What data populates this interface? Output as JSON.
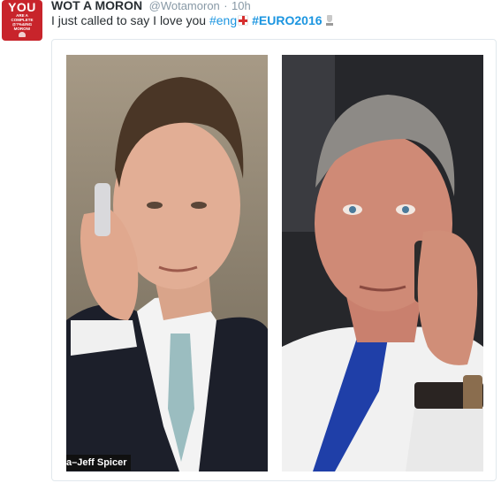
{
  "tweet": {
    "avatar": {
      "line1": "YOU",
      "line2": "ARE A COMPLETE",
      "line3": "@?%&ING",
      "line4": "MORON!"
    },
    "author_name": "WOT A MORON",
    "author_handle": "@Wotamoron",
    "separator": "·",
    "timestamp": "10h",
    "text_prefix": "I just called to say I love you ",
    "hashtag_eng": "#eng",
    "hashtag_euro": "#EURO2016",
    "emoji": {
      "flag": "england-flag-icon",
      "trophy": "trophy-icon"
    }
  },
  "media": {
    "photo_credit": "a–Jeff Spicer"
  },
  "colors": {
    "link": "#1b95e0",
    "name": "#292f33",
    "meta": "#8899a6",
    "avatar_bg": "#c8242b"
  }
}
